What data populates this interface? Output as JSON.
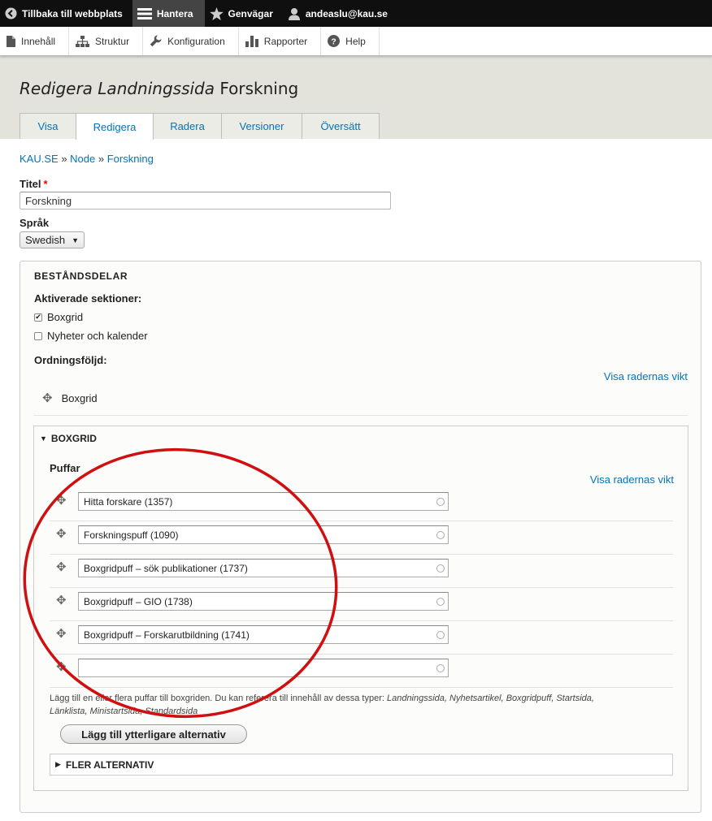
{
  "toolbar": {
    "back_label": "Tillbaka till webbplats",
    "manage_label": "Hantera",
    "shortcuts_label": "Genvägar",
    "user_label": "andeaslu@kau.se"
  },
  "admin_menu": [
    "Innehåll",
    "Struktur",
    "Konfiguration",
    "Rapporter",
    "Help"
  ],
  "page": {
    "title_em": "Redigera Landningssida",
    "title_rest": " Forskning",
    "tabs": [
      "Visa",
      "Redigera",
      "Radera",
      "Versioner",
      "Översätt"
    ],
    "active_tab": "Redigera"
  },
  "breadcrumb": {
    "items": [
      "KAU.SE",
      "Node",
      "Forskning"
    ],
    "separator": "»"
  },
  "title_field": {
    "label": "Titel",
    "required_mark": "*",
    "value": "Forskning"
  },
  "language_field": {
    "label": "Språk",
    "value": "Swedish"
  },
  "components": {
    "legend": "BESTÅNDSDELAR",
    "enabled_label": "Aktiverade sektioner:",
    "sections": [
      {
        "label": "Boxgrid",
        "checked": true
      },
      {
        "label": "Nyheter och kalender",
        "checked": false
      }
    ],
    "order_label": "Ordningsföljd:",
    "show_weights": "Visa radernas vikt",
    "order_items": [
      "Boxgrid"
    ]
  },
  "boxgrid": {
    "legend": "BOXGRID",
    "puffar_label": "Puffar",
    "show_weights": "Visa radernas vikt",
    "items": [
      "Hitta forskare (1357)",
      "Forskningspuff (1090)",
      "Boxgridpuff – sök publikationer (1737)",
      "Boxgridpuff – GIO (1738)",
      "Boxgridpuff – Forskarutbildning (1741)",
      ""
    ],
    "description_prefix": "Lägg till en eller flera puffar till boxgriden. Du kan referera till innehåll av dessa typer: ",
    "description_types_line1": "Landningssida, Nyhetsartikel, Boxgridpuff, Startsida,",
    "description_types_line2": "Länklista, Ministartsida, Standardsida",
    "add_more_button": "Lägg till ytterligare alternativ",
    "more_options": "FLER ALTERNATIV"
  },
  "colors": {
    "link": "#0074bd",
    "toolbar_bg": "#0f0f0f",
    "annotation_circle": "#d01010"
  }
}
